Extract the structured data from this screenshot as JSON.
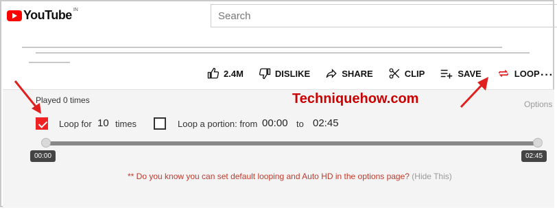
{
  "brand": {
    "name": "YouTube",
    "region": "IN"
  },
  "search": {
    "placeholder": "Search"
  },
  "actions": {
    "like": "2.4M",
    "dislike": "DISLIKE",
    "share": "SHARE",
    "clip": "CLIP",
    "save": "SAVE",
    "loop": "LOOP"
  },
  "panel": {
    "played": "Played 0 times",
    "watermark": "Techniquehow.com",
    "options": "Options",
    "loop_for_label": "Loop for",
    "loop_count": "10",
    "times_label": "times",
    "portion_label": "Loop a portion: from",
    "from": "00:00",
    "to_label": "to",
    "to": "02:45",
    "tip_start": "00:00",
    "tip_end": "02:45",
    "hint": "** Do you know you can set default looping and Auto HD in the options page?",
    "hide": "(Hide This)"
  },
  "colors": {
    "accent": "#ff0000",
    "arrow": "#e01f1f",
    "hint": "#c0392b"
  },
  "icons": [
    "youtube-logo-icon",
    "thumbs-up-icon",
    "thumbs-down-icon",
    "share-icon",
    "scissors-icon",
    "playlist-add-icon",
    "loop-icon",
    "more-icon",
    "check-icon"
  ]
}
